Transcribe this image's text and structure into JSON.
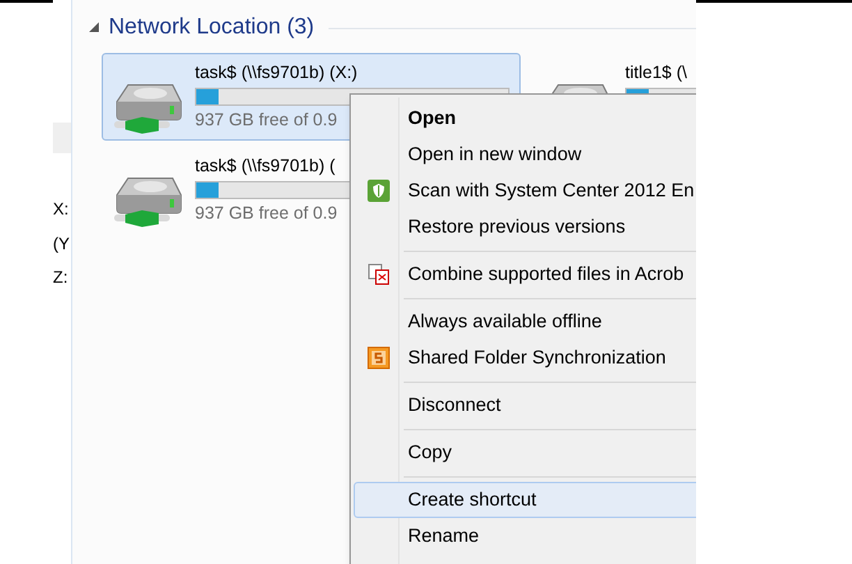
{
  "nav_pane": {
    "items": [
      "X:",
      "(Y",
      "Z:"
    ]
  },
  "group": {
    "title": "Network Location (3)",
    "expanded": true
  },
  "drives": [
    {
      "name": "task$ (\\\\fs9701b) (X:)",
      "level": 0.07,
      "free": "937 GB free of 0.9",
      "selected": true
    },
    {
      "name": "task$ (\\\\fs9701b) (",
      "level": 0.07,
      "free": "937 GB free of 0.9",
      "selected": false
    },
    {
      "name": "title1$ (\\",
      "level": 0.07,
      "selected": false
    }
  ],
  "context_menu": [
    {
      "kind": "item",
      "label": "Open",
      "bold": true,
      "selected": false
    },
    {
      "kind": "item",
      "label": "Open in new window",
      "bold": false,
      "selected": false
    },
    {
      "kind": "shield",
      "label": "Scan with System Center 2012 En",
      "bold": false,
      "selected": false
    },
    {
      "kind": "item",
      "label": "Restore previous versions",
      "bold": false,
      "selected": false
    },
    {
      "kind": "separator"
    },
    {
      "kind": "pdf",
      "label": "Combine supported files in Acrob",
      "bold": false,
      "selected": false
    },
    {
      "kind": "separator"
    },
    {
      "kind": "item",
      "label": "Always available offline",
      "bold": false,
      "selected": false
    },
    {
      "kind": "sync",
      "label": "Shared Folder Synchronization",
      "bold": false,
      "selected": false
    },
    {
      "kind": "separator"
    },
    {
      "kind": "item",
      "label": "Disconnect",
      "bold": false,
      "selected": false
    },
    {
      "kind": "separator"
    },
    {
      "kind": "item",
      "label": "Copy",
      "bold": false,
      "selected": false
    },
    {
      "kind": "separator"
    },
    {
      "kind": "item",
      "label": "Create shortcut",
      "bold": false,
      "selected": true
    },
    {
      "kind": "item",
      "label": "Rename",
      "bold": false,
      "selected": false
    }
  ]
}
